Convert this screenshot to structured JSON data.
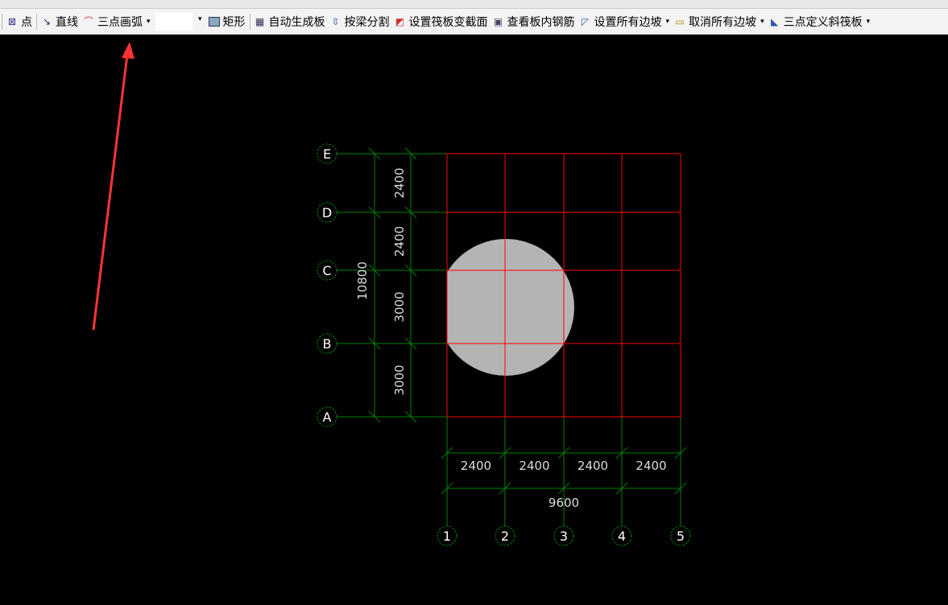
{
  "toolbar": {
    "items": [
      {
        "label": "点",
        "icon": "point-icon"
      },
      {
        "label": "直线",
        "icon": "line-icon"
      },
      {
        "label": "三点画弧",
        "icon": "arc-icon"
      },
      {
        "label": "矩形",
        "icon": "rectangle-icon"
      },
      {
        "label": "自动生成板",
        "icon": "auto-slab-icon"
      },
      {
        "label": "按梁分割",
        "icon": "split-by-beam-icon"
      },
      {
        "label": "设置筏板变截面",
        "icon": "raft-section-icon"
      },
      {
        "label": "查看板内钢筋",
        "icon": "view-rebar-icon"
      },
      {
        "label": "设置所有边坡",
        "icon": "set-slope-icon"
      },
      {
        "label": "取消所有边坡",
        "icon": "cancel-slope-icon"
      },
      {
        "label": "三点定义斜筏板",
        "icon": "sloped-raft-icon"
      }
    ]
  },
  "drawing": {
    "row_axes": [
      "E",
      "D",
      "C",
      "B",
      "A"
    ],
    "col_axes": [
      "1",
      "2",
      "3",
      "4",
      "5"
    ],
    "row_dims": [
      "2400",
      "2400",
      "3000",
      "3000"
    ],
    "row_total": "10800",
    "col_dims": [
      "2400",
      "2400",
      "2400",
      "2400"
    ],
    "col_total": "9600",
    "colors": {
      "grid_red": "#ff0000",
      "grid_green": "#008000",
      "fill": "#b4b4b4",
      "arrow": "#ff3333"
    }
  }
}
